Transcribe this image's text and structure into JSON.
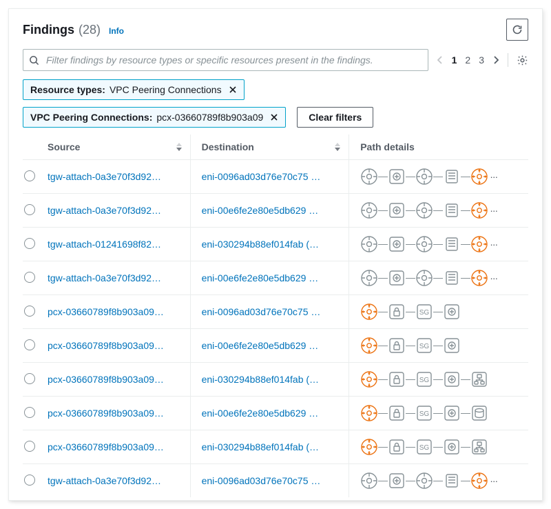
{
  "header": {
    "title": "Findings",
    "count": "(28)",
    "info_label": "Info"
  },
  "search": {
    "placeholder": "Filter findings by resource types or specific resources present in the findings."
  },
  "pagination": {
    "pages": [
      "1",
      "2",
      "3"
    ],
    "active_index": 0
  },
  "filters": {
    "token1_label": "Resource types:",
    "token1_value": "VPC Peering Connections",
    "token2_label": "VPC Peering Connections:",
    "token2_value": "pcx-03660789f8b903a09",
    "clear_label": "Clear filters"
  },
  "columns": {
    "source": "Source",
    "destination": "Destination",
    "path": "Path details"
  },
  "rows": [
    {
      "source": "tgw-attach-0a3e70f3d92…",
      "destination": "eni-0096ad03d76e70c75 …",
      "path": [
        "generic",
        "generic-sq",
        "generic",
        "server",
        "target"
      ],
      "more": true
    },
    {
      "source": "tgw-attach-0a3e70f3d92…",
      "destination": "eni-00e6fe2e80e5db629 …",
      "path": [
        "generic",
        "generic-sq",
        "generic",
        "server",
        "target"
      ],
      "more": true
    },
    {
      "source": "tgw-attach-01241698f82…",
      "destination": "eni-030294b88ef014fab (…",
      "path": [
        "generic",
        "generic-sq",
        "generic",
        "server",
        "target"
      ],
      "more": true
    },
    {
      "source": "tgw-attach-0a3e70f3d92…",
      "destination": "eni-00e6fe2e80e5db629 …",
      "path": [
        "generic",
        "generic-sq",
        "generic",
        "server",
        "target"
      ],
      "more": true
    },
    {
      "source": "pcx-03660789f8b903a09…",
      "destination": "eni-0096ad03d76e70c75 …",
      "path": [
        "target",
        "lock-sq",
        "sg",
        "generic-sq"
      ],
      "more": false
    },
    {
      "source": "pcx-03660789f8b903a09…",
      "destination": "eni-00e6fe2e80e5db629 …",
      "path": [
        "target",
        "lock-sq",
        "sg",
        "generic-sq"
      ],
      "more": false
    },
    {
      "source": "pcx-03660789f8b903a09…",
      "destination": "eni-030294b88ef014fab (…",
      "path": [
        "target",
        "lock-sq",
        "sg",
        "generic-sq",
        "tree"
      ],
      "more": false
    },
    {
      "source": "pcx-03660789f8b903a09…",
      "destination": "eni-00e6fe2e80e5db629 …",
      "path": [
        "target",
        "lock-sq",
        "sg",
        "generic-sq",
        "disk"
      ],
      "more": false
    },
    {
      "source": "pcx-03660789f8b903a09…",
      "destination": "eni-030294b88ef014fab (…",
      "path": [
        "target",
        "lock-sq",
        "sg",
        "generic-sq",
        "tree"
      ],
      "more": false
    },
    {
      "source": "tgw-attach-0a3e70f3d92…",
      "destination": "eni-0096ad03d76e70c75 …",
      "path": [
        "generic",
        "generic-sq",
        "generic",
        "server",
        "target"
      ],
      "more": true
    }
  ]
}
